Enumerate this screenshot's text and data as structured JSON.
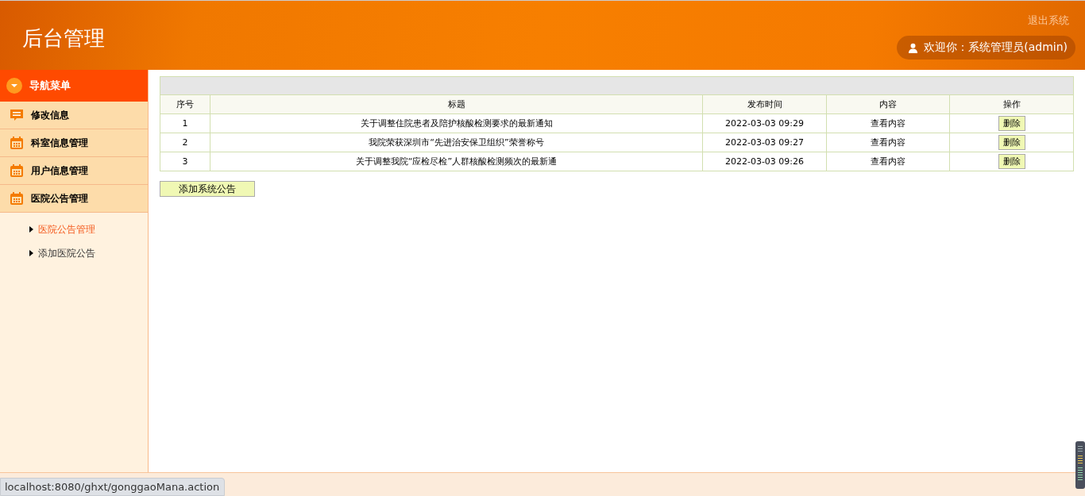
{
  "header": {
    "title": "后台管理",
    "logout_link": "退出系统",
    "welcome": "欢迎你：系统管理员(admin)"
  },
  "sidebar": {
    "heading": "导航菜单",
    "groups": [
      {
        "label": "修改信息"
      },
      {
        "label": "科室信息管理"
      },
      {
        "label": "用户信息管理"
      },
      {
        "label": "医院公告管理",
        "children": [
          {
            "label": "医院公告管理",
            "selected": true
          },
          {
            "label": "添加医院公告",
            "selected": false
          }
        ]
      }
    ]
  },
  "table": {
    "columns": [
      "序号",
      "标题",
      "发布时间",
      "内容",
      "操作"
    ],
    "rows": [
      {
        "index": "1",
        "title": "关于调整住院患者及陪护核酸检测要求的最新通知",
        "time": "2022-03-03 09:29",
        "content_link": "查看内容",
        "action": "删除"
      },
      {
        "index": "2",
        "title": "我院荣获深圳市“先进治安保卫组织”荣誉称号",
        "time": "2022-03-03 09:27",
        "content_link": "查看内容",
        "action": "删除"
      },
      {
        "index": "3",
        "title": "关于调整我院“应检尽检”人群核酸检测频次的最新通",
        "time": "2022-03-03 09:26",
        "content_link": "查看内容",
        "action": "删除"
      }
    ]
  },
  "add_button": "添加系统公告",
  "status_url": "localhost:8080/ghxt/gonggaoMana.action"
}
